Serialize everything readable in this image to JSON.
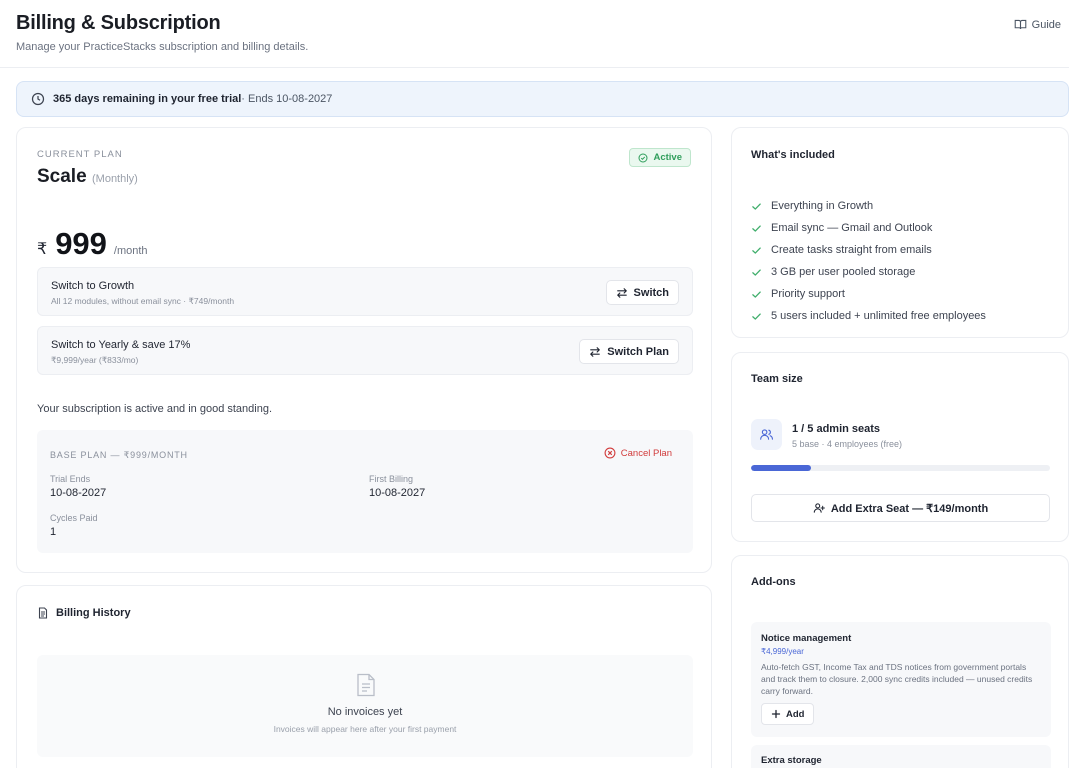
{
  "header": {
    "title": "Billing & Subscription",
    "subtitle": "Manage your PracticeStacks subscription and billing details.",
    "guide_label": "Guide"
  },
  "trial": {
    "days_text": "365 days remaining in your free trial",
    "ends_text": " · Ends 10-08-2027"
  },
  "plan": {
    "eyebrow": "CURRENT PLAN",
    "name": "Scale",
    "cycle": "(Monthly)",
    "status": "Active",
    "currency": "₹",
    "amount": "999",
    "per": "/month",
    "switch_options": [
      {
        "title": "Switch to Growth",
        "subtitle": "All 12 modules, without email sync · ₹749/month",
        "button": "Switch"
      },
      {
        "title": "Switch to Yearly & save 17%",
        "subtitle": "₹9,999/year (₹833/mo)",
        "button": "Switch Plan"
      }
    ],
    "status_message": "Your subscription is active and in good standing.",
    "base_plan": {
      "heading": "BASE PLAN — ₹999/MONTH",
      "cancel_label": "Cancel Plan",
      "trial_ends_label": "Trial Ends",
      "trial_ends_value": "10-08-2027",
      "first_billing_label": "First Billing",
      "first_billing_value": "10-08-2027",
      "cycles_label": "Cycles Paid",
      "cycles_value": "1"
    }
  },
  "billing_history": {
    "title": "Billing History",
    "empty_title": "No invoices yet",
    "empty_subtitle": "Invoices will appear here after your first payment"
  },
  "included": {
    "title": "What's included",
    "features": [
      "Everything in Growth",
      "Email sync — Gmail and Outlook",
      "Create tasks straight from emails",
      "3 GB per user pooled storage",
      "Priority support",
      "5 users included + unlimited free employees"
    ]
  },
  "team": {
    "title": "Team size",
    "seats_text": "1 / 5 admin seats",
    "seats_detail": "5 base · 4 employees (free)",
    "seats_used_fraction": 0.2,
    "add_seat_label": "Add Extra Seat — ₹149/month"
  },
  "addons": {
    "title": "Add-ons",
    "items": [
      {
        "name": "Notice management",
        "price": "₹4,999/year",
        "description": "Auto-fetch GST, Income Tax and TDS notices from government portals and track them to closure. 2,000 sync credits included — unused credits carry forward.",
        "button": "Add"
      },
      {
        "name": "Extra storage"
      }
    ]
  },
  "colors": {
    "accent": "#4a67d6",
    "success": "#2f9e5b",
    "danger": "#d13b3b",
    "banner_bg": "#eef4fc"
  }
}
